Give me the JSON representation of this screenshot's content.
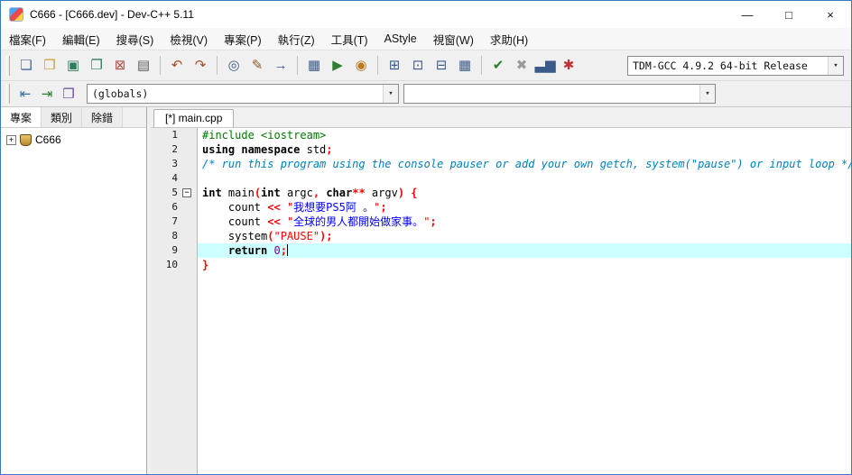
{
  "window": {
    "title": "C666 - [C666.dev] - Dev-C++ 5.11"
  },
  "menu": {
    "items": [
      "檔案(F)",
      "編輯(E)",
      "搜尋(S)",
      "檢視(V)",
      "專案(P)",
      "執行(Z)",
      "工具(T)",
      "AStyle",
      "視窗(W)",
      "求助(H)"
    ]
  },
  "toolbar": {
    "compiler_select": "TDM-GCC 4.9.2 64-bit Release",
    "groups": [
      [
        {
          "name": "new-file",
          "glyph": "❏",
          "color": "#4a6a9a"
        },
        {
          "name": "open-file",
          "glyph": "❒",
          "color": "#c89a3a"
        },
        {
          "name": "save-file",
          "glyph": "▣",
          "color": "#2e7d5a"
        },
        {
          "name": "save-all",
          "glyph": "❐",
          "color": "#2e7d5a"
        },
        {
          "name": "close-file",
          "glyph": "⊠",
          "color": "#b04a4a"
        },
        {
          "name": "print",
          "glyph": "▤",
          "color": "#5a5a5a"
        }
      ],
      [
        {
          "name": "undo",
          "glyph": "↶",
          "color": "#a0522d"
        },
        {
          "name": "redo",
          "glyph": "↷",
          "color": "#a0522d"
        }
      ],
      [
        {
          "name": "find",
          "glyph": "◎",
          "color": "#3a5a8a"
        },
        {
          "name": "replace",
          "glyph": "✎",
          "color": "#8a5a2a"
        },
        {
          "name": "goto-line",
          "glyph": "→",
          "color": "#3a5a8a"
        }
      ],
      [
        {
          "name": "compile",
          "glyph": "▦",
          "color": "#3a5a8a"
        },
        {
          "name": "run",
          "glyph": "▶",
          "color": "#2e7d32"
        },
        {
          "name": "compile-and-run",
          "glyph": "◉",
          "color": "#c07820"
        }
      ],
      [
        {
          "name": "new-project",
          "glyph": "⊞",
          "color": "#3a5a8a"
        },
        {
          "name": "add-to-project",
          "glyph": "⊡",
          "color": "#3a5a8a"
        },
        {
          "name": "remove-from-project",
          "glyph": "⊟",
          "color": "#3a5a8a"
        },
        {
          "name": "project-options",
          "glyph": "▦",
          "color": "#3a5a8a"
        }
      ],
      [
        {
          "name": "syntax-check",
          "glyph": "✔",
          "color": "#2e7d32"
        },
        {
          "name": "abort-compilation",
          "glyph": "✖",
          "color": "#9a9a9a"
        },
        {
          "name": "profile-analysis",
          "glyph": "▃▆",
          "color": "#3a5a8a"
        },
        {
          "name": "delete-profiling-data",
          "glyph": "✱",
          "color": "#c03030"
        }
      ]
    ]
  },
  "classbar": {
    "scope_select": "(globals)",
    "member_select": "",
    "buttons": [
      {
        "name": "goto-declaration",
        "glyph": "⇤",
        "color": "#3a6ea5"
      },
      {
        "name": "goto-definition",
        "glyph": "⇥",
        "color": "#2e7d32"
      },
      {
        "name": "switch-header-source",
        "glyph": "❒",
        "color": "#6a4a9a"
      }
    ]
  },
  "sidebar": {
    "tabs": [
      {
        "id": "projects",
        "label": "專案",
        "active": true
      },
      {
        "id": "classes",
        "label": "類別",
        "active": false
      },
      {
        "id": "debug",
        "label": "除錯",
        "active": false
      }
    ],
    "tree": [
      {
        "label": "C666",
        "expandable": true
      }
    ]
  },
  "editor": {
    "tabs": [
      {
        "id": "main-cpp",
        "label": "[*] main.cpp",
        "active": true
      }
    ],
    "lines": [
      {
        "num": 1,
        "segments": [
          {
            "t": "#include <iostream>",
            "c": "pre"
          }
        ]
      },
      {
        "num": 2,
        "segments": [
          {
            "t": "using namespace",
            "c": "kw"
          },
          {
            "t": " std",
            "c": "pl"
          },
          {
            "t": ";",
            "c": "sym"
          }
        ]
      },
      {
        "num": 3,
        "segments": [
          {
            "t": "/* run this program using the console pauser or add your own getch, system(\"pause\") or input loop */",
            "c": "com"
          }
        ]
      },
      {
        "num": 4,
        "segments": []
      },
      {
        "num": 5,
        "fold": "open",
        "segments": [
          {
            "t": "int",
            "c": "kw"
          },
          {
            "t": " main",
            "c": "pl"
          },
          {
            "t": "(",
            "c": "sym"
          },
          {
            "t": "int",
            "c": "kw"
          },
          {
            "t": " argc",
            "c": "pl"
          },
          {
            "t": ",",
            "c": "sym"
          },
          {
            "t": " ",
            "c": "pl"
          },
          {
            "t": "char",
            "c": "kw"
          },
          {
            "t": "**",
            "c": "sym"
          },
          {
            "t": " argv",
            "c": "pl"
          },
          {
            "t": ")",
            "c": "sym"
          },
          {
            "t": " ",
            "c": "pl"
          },
          {
            "t": "{",
            "c": "sym"
          }
        ]
      },
      {
        "num": 6,
        "segments": [
          {
            "t": "    count ",
            "c": "pl"
          },
          {
            "t": "<<",
            "c": "sym"
          },
          {
            "t": " ",
            "c": "pl"
          },
          {
            "t": "\"",
            "c": "str"
          },
          {
            "t": "我想要PS5阿 。",
            "c": "wstr"
          },
          {
            "t": "\"",
            "c": "str"
          },
          {
            "t": ";",
            "c": "sym"
          }
        ]
      },
      {
        "num": 7,
        "segments": [
          {
            "t": "    count ",
            "c": "pl"
          },
          {
            "t": "<<",
            "c": "sym"
          },
          {
            "t": " ",
            "c": "pl"
          },
          {
            "t": "\"",
            "c": "str"
          },
          {
            "t": "全球的男人都開始做家事。",
            "c": "wstr"
          },
          {
            "t": "\"",
            "c": "str"
          },
          {
            "t": ";",
            "c": "sym"
          }
        ]
      },
      {
        "num": 8,
        "segments": [
          {
            "t": "    system",
            "c": "pl"
          },
          {
            "t": "(",
            "c": "sym"
          },
          {
            "t": "\"PAUSE\"",
            "c": "str"
          },
          {
            "t": ")",
            "c": "sym"
          },
          {
            "t": ";",
            "c": "sym"
          }
        ]
      },
      {
        "num": 9,
        "highlight": true,
        "caret": true,
        "segments": [
          {
            "t": "    ",
            "c": "pl"
          },
          {
            "t": "return",
            "c": "kw"
          },
          {
            "t": " ",
            "c": "pl"
          },
          {
            "t": "0",
            "c": "num"
          },
          {
            "t": ";",
            "c": "sym"
          }
        ]
      },
      {
        "num": 10,
        "segments": [
          {
            "t": "}",
            "c": "sym"
          }
        ]
      }
    ]
  },
  "icons": {
    "dropdown": "▾",
    "minimize": "—",
    "maximize": "□",
    "close": "×",
    "expand": "+",
    "fold_open": "−"
  },
  "colors": {
    "current_line": "#ccffff",
    "string": "#ff0000",
    "wide_string": "#0000ff",
    "comment": "#0080c0",
    "preprocessor": "#007800",
    "number": "#800080",
    "symbol": "#ff0000",
    "accent_border": "#3b78c3"
  }
}
